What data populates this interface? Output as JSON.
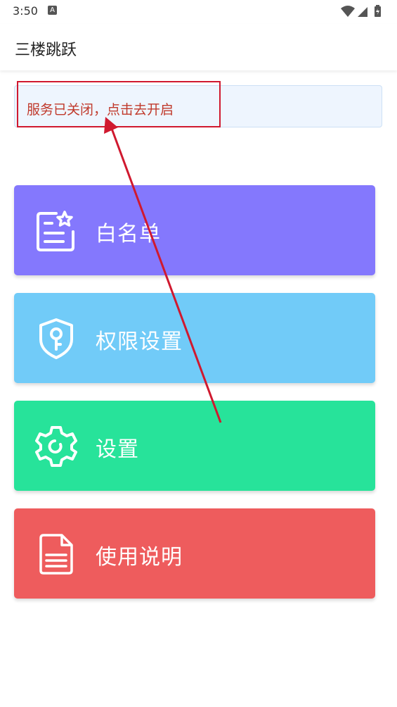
{
  "status_bar": {
    "time": "3:50",
    "notification_icon": "a-icon",
    "icons": [
      "wifi-icon",
      "signal-icon",
      "battery-icon"
    ]
  },
  "app_bar": {
    "title": "三楼跳跃"
  },
  "notice": {
    "text": "服务已关闭，点击去开启",
    "color": "#c0392b"
  },
  "cards": [
    {
      "label": "白名单",
      "icon": "whitelist-icon",
      "color": "#8478fd"
    },
    {
      "label": "权限设置",
      "icon": "shield-key-icon",
      "color": "#71cbf8"
    },
    {
      "label": "设置",
      "icon": "gear-icon",
      "color": "#27e39a"
    },
    {
      "label": "使用说明",
      "icon": "document-icon",
      "color": "#ee5c5d"
    }
  ],
  "annotation": {
    "highlight_color": "#d0192f"
  }
}
